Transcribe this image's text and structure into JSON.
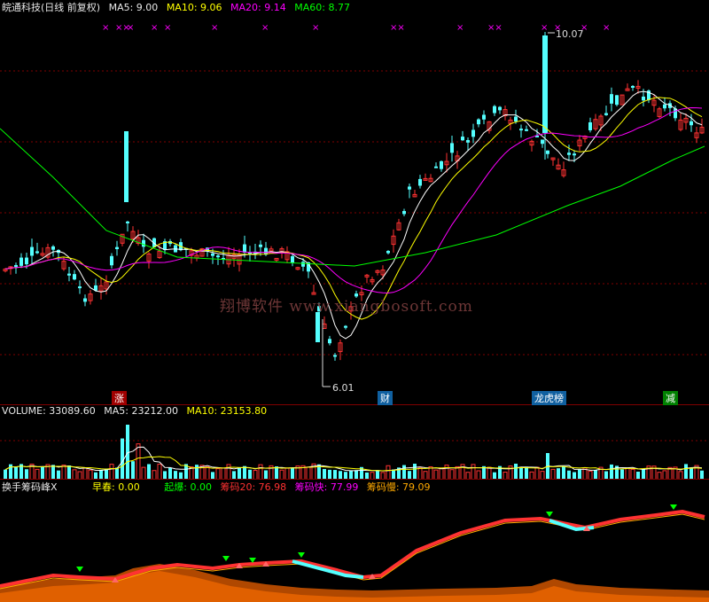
{
  "price": {
    "name": "皖通科技(日线 前复权)",
    "ma5": "MA5: 9.00",
    "ma10": "MA10: 9.06",
    "ma20": "MA20: 9.14",
    "ma60": "MA60: 8.77",
    "high_label": "10.07",
    "low_label": "6.01",
    "markers": [
      "×",
      "××",
      "×",
      "×",
      "×",
      "×",
      "×",
      "×",
      "××",
      "×",
      "××",
      "×",
      "×",
      "×",
      "×"
    ],
    "tags": [
      "涨",
      "财",
      "龙虎榜",
      "减"
    ],
    "watermark": "翔博软件 www.xiangbosoft.com"
  },
  "volume": {
    "title": "VOLUME: 33089.60",
    "ma5": "MA5: 23212.00",
    "ma10": "MA10: 23153.80"
  },
  "indicator": {
    "title": "换手筹码峰X",
    "zaochun": "早春: 0.00",
    "qibao": "起爆: 0.00",
    "chouma20": "筹码20: 76.98",
    "choumakuai": "筹码快: 77.99",
    "choumaman": "筹码慢: 79.09"
  },
  "colors": {
    "up": "#ff3232",
    "down": "#54ffff",
    "ma5": "#ffffff",
    "ma10": "#ffff00",
    "ma20": "#ff00ff",
    "ma60": "#00ff00",
    "grid": "#800000",
    "orange_area": "#e06000"
  }
}
